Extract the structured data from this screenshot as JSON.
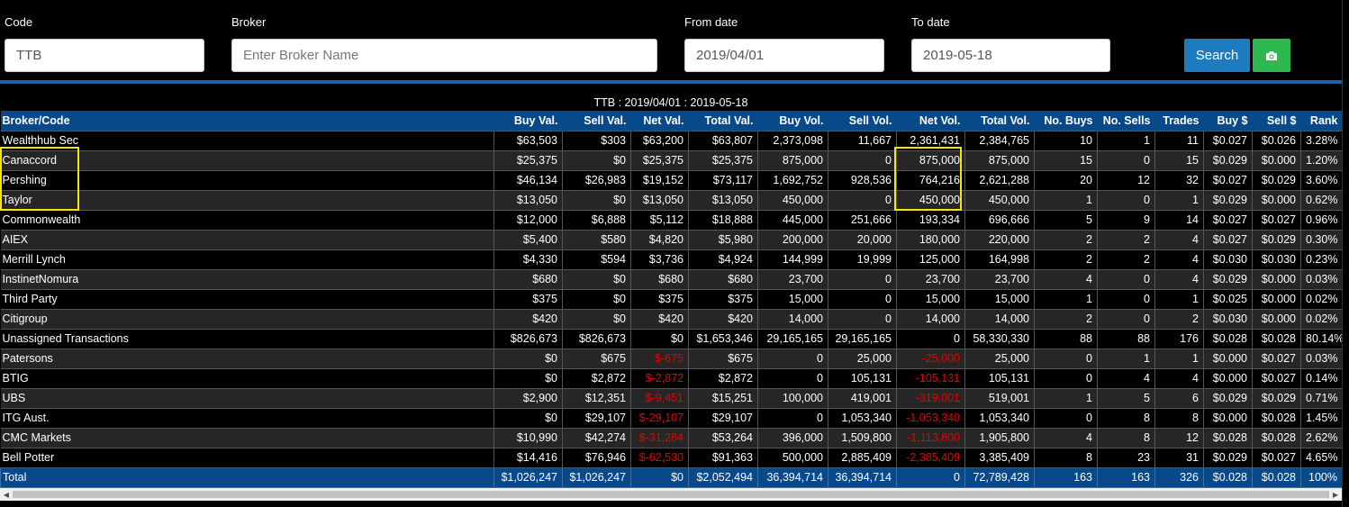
{
  "filters": {
    "code_label": "Code",
    "code_value": "TTB",
    "broker_label": "Broker",
    "broker_placeholder": "Enter Broker Name",
    "from_label": "From date",
    "from_value": "2019/04/01",
    "to_label": "To date",
    "to_value": "2019-05-18",
    "search_label": "Search",
    "camera_icon": "camera-icon"
  },
  "caption": "TTB : 2019/04/01 : 2019-05-18",
  "colors": {
    "header_bg": "#08498a",
    "search_btn": "#1f7bbf",
    "camera_btn": "#2fb84f",
    "negative": "#e60000",
    "highlight": "#f5e60a"
  },
  "columns": [
    "Broker/Code",
    "Buy Val.",
    "Sell Val.",
    "Net Val.",
    "Total Val.",
    "Buy Vol.",
    "Sell Vol.",
    "Net Vol.",
    "Total Vol.",
    "No. Buys",
    "No. Sells",
    "Trades",
    "Buy $",
    "Sell $",
    "Rank"
  ],
  "rows": [
    [
      "Wealthhub Sec",
      "$63,503",
      "$303",
      "$63,200",
      "$63,807",
      "2,373,098",
      "11,667",
      "2,361,431",
      "2,384,765",
      "10",
      "1",
      "11",
      "$0.027",
      "$0.026",
      "3.28%"
    ],
    [
      "Canaccord",
      "$25,375",
      "$0",
      "$25,375",
      "$25,375",
      "875,000",
      "0",
      "875,000",
      "875,000",
      "15",
      "0",
      "15",
      "$0.029",
      "$0.000",
      "1.20%"
    ],
    [
      "Pershing",
      "$46,134",
      "$26,983",
      "$19,152",
      "$73,117",
      "1,692,752",
      "928,536",
      "764,216",
      "2,621,288",
      "20",
      "12",
      "32",
      "$0.027",
      "$0.029",
      "3.60%"
    ],
    [
      "Taylor",
      "$13,050",
      "$0",
      "$13,050",
      "$13,050",
      "450,000",
      "0",
      "450,000",
      "450,000",
      "1",
      "0",
      "1",
      "$0.029",
      "$0.000",
      "0.62%"
    ],
    [
      "Commonwealth",
      "$12,000",
      "$6,888",
      "$5,112",
      "$18,888",
      "445,000",
      "251,666",
      "193,334",
      "696,666",
      "5",
      "9",
      "14",
      "$0.027",
      "$0.027",
      "0.96%"
    ],
    [
      "AIEX",
      "$5,400",
      "$580",
      "$4,820",
      "$5,980",
      "200,000",
      "20,000",
      "180,000",
      "220,000",
      "2",
      "2",
      "4",
      "$0.027",
      "$0.029",
      "0.30%"
    ],
    [
      "Merrill Lynch",
      "$4,330",
      "$594",
      "$3,736",
      "$4,924",
      "144,999",
      "19,999",
      "125,000",
      "164,998",
      "2",
      "2",
      "4",
      "$0.030",
      "$0.030",
      "0.23%"
    ],
    [
      "InstinetNomura",
      "$680",
      "$0",
      "$680",
      "$680",
      "23,700",
      "0",
      "23,700",
      "23,700",
      "4",
      "0",
      "4",
      "$0.029",
      "$0.000",
      "0.03%"
    ],
    [
      "Third Party",
      "$375",
      "$0",
      "$375",
      "$375",
      "15,000",
      "0",
      "15,000",
      "15,000",
      "1",
      "0",
      "1",
      "$0.025",
      "$0.000",
      "0.02%"
    ],
    [
      "Citigroup",
      "$420",
      "$0",
      "$420",
      "$420",
      "14,000",
      "0",
      "14,000",
      "14,000",
      "2",
      "0",
      "2",
      "$0.030",
      "$0.000",
      "0.02%"
    ],
    [
      "Unassigned Transactions",
      "$826,673",
      "$826,673",
      "$0",
      "$1,653,346",
      "29,165,165",
      "29,165,165",
      "0",
      "58,330,330",
      "88",
      "88",
      "176",
      "$0.028",
      "$0.028",
      "80.14%"
    ],
    [
      "Patersons",
      "$0",
      "$675",
      "$-675",
      "$675",
      "0",
      "25,000",
      "-25,000",
      "25,000",
      "0",
      "1",
      "1",
      "$0.000",
      "$0.027",
      "0.03%"
    ],
    [
      "BTIG",
      "$0",
      "$2,872",
      "$-2,872",
      "$2,872",
      "0",
      "105,131",
      "-105,131",
      "105,131",
      "0",
      "4",
      "4",
      "$0.000",
      "$0.027",
      "0.14%"
    ],
    [
      "UBS",
      "$2,900",
      "$12,351",
      "$-9,451",
      "$15,251",
      "100,000",
      "419,001",
      "-319,001",
      "519,001",
      "1",
      "5",
      "6",
      "$0.029",
      "$0.029",
      "0.71%"
    ],
    [
      "ITG Aust.",
      "$0",
      "$29,107",
      "$-29,107",
      "$29,107",
      "0",
      "1,053,340",
      "-1,053,340",
      "1,053,340",
      "0",
      "8",
      "8",
      "$0.000",
      "$0.028",
      "1.45%"
    ],
    [
      "CMC Markets",
      "$10,990",
      "$42,274",
      "$-31,284",
      "$53,264",
      "396,000",
      "1,509,800",
      "-1,113,800",
      "1,905,800",
      "4",
      "8",
      "12",
      "$0.028",
      "$0.028",
      "2.62%"
    ],
    [
      "Bell Potter",
      "$14,416",
      "$76,946",
      "$-62,530",
      "$91,363",
      "500,000",
      "2,885,409",
      "-2,385,409",
      "3,385,409",
      "8",
      "23",
      "31",
      "$0.029",
      "$0.027",
      "4.65%"
    ]
  ],
  "total": [
    "Total",
    "$1,026,247",
    "$1,026,247",
    "$0",
    "$2,052,494",
    "36,394,714",
    "36,394,714",
    "0",
    "72,789,428",
    "163",
    "163",
    "326",
    "$0.028",
    "$0.028",
    "100%"
  ],
  "scrollbar": {
    "left_arrow": "◀",
    "right_arrow": "▶"
  }
}
